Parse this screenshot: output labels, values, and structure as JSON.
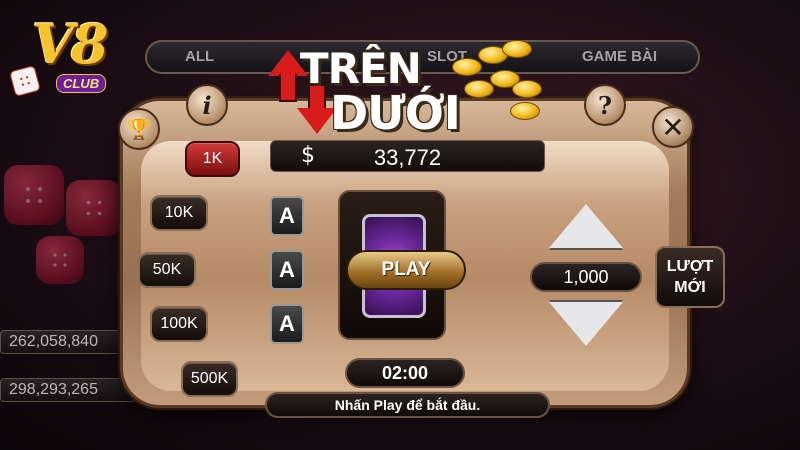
{
  "brand": {
    "logo_text": "V8",
    "logo_sub": "CLUB"
  },
  "lobby": {
    "tabs": [
      "ALL",
      "SLOT",
      "GAME BÀI"
    ],
    "jackpots": [
      "262,058,840",
      "298,293,265"
    ]
  },
  "dialog": {
    "title_line1": "TRÊN",
    "title_line2": "DƯỚI",
    "icons": {
      "trophy": "🏆",
      "info": "i",
      "help": "?",
      "close": "✕",
      "dollar": "$"
    },
    "balance": "33,772",
    "chips": [
      "1K",
      "10K",
      "50K",
      "100K",
      "500K"
    ],
    "selected_chip": "1K",
    "cards": [
      "A",
      "A",
      "A"
    ],
    "play_label": "PLAY",
    "timer": "02:00",
    "hint": "Nhấn Play để bắt đầu.",
    "bet_value": "1,000",
    "new_round_line1": "LƯỢT",
    "new_round_line2": "MỚI"
  },
  "colors": {
    "accent_red": "#d81b1b",
    "gold": "#f4c430",
    "panel": "#b58a66"
  }
}
